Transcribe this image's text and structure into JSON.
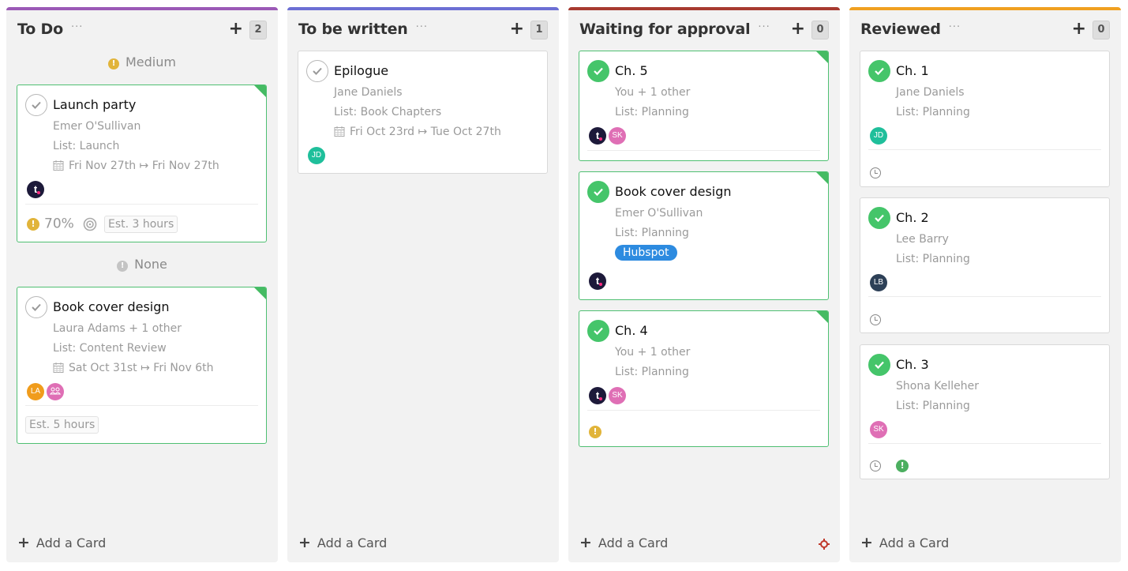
{
  "colors": {
    "todo": "#9b59b6",
    "to_be_written": "#6c6fd4",
    "waiting": "#a73a30",
    "reviewed": "#f0a020",
    "medium_priority": "#e1b43a",
    "none_priority": "#c4c4c4",
    "done_green": "#45c56a",
    "tag_blue": "#2d8be0",
    "high_priority_green": "#4caf60"
  },
  "columns": [
    {
      "title": "To Do",
      "more": "···",
      "count": "2",
      "add_label": "Add a Card",
      "groups": [
        {
          "label": "Medium",
          "cards": [
            {
              "title": "Launch party",
              "assignee": "Emer O'Sullivan",
              "list": "List: Launch",
              "dates": "Fri Nov 27th ↦ Fri Nov 27th",
              "avatars": [
                "t"
              ],
              "progress": "70%",
              "estimate": "Est. 3 hours"
            }
          ]
        },
        {
          "label": "None",
          "cards": [
            {
              "title": "Book cover design",
              "assignee": "Laura Adams + 1 other",
              "list": "List: Content Review",
              "dates": "Sat Oct 31st ↦ Fri Nov 6th",
              "avatars": [
                "LA",
                "group"
              ],
              "estimate": "Est. 5 hours"
            }
          ]
        }
      ]
    },
    {
      "title": "To be written",
      "more": "···",
      "count": "1",
      "add_label": "Add a Card",
      "cards": [
        {
          "title": "Epilogue",
          "assignee": "Jane Daniels",
          "list": "List: Book Chapters",
          "dates": "Fri Oct 23rd ↦ Tue Oct 27th",
          "avatars": [
            "JD"
          ]
        }
      ]
    },
    {
      "title": "Waiting for approval",
      "more": "···",
      "count": "0",
      "add_label": "Add a Card",
      "cards": [
        {
          "title": "Ch. 5",
          "assignee": "You + 1 other",
          "list": "List: Planning",
          "avatars": [
            "t",
            "SK"
          ]
        },
        {
          "title": "Book cover design",
          "assignee": "Emer O'Sullivan",
          "list": "List: Planning",
          "tag": "Hubspot",
          "avatars": [
            "t"
          ]
        },
        {
          "title": "Ch. 4",
          "assignee": "You + 1 other",
          "list": "List: Planning",
          "avatars": [
            "t",
            "SK"
          ]
        }
      ]
    },
    {
      "title": "Reviewed",
      "more": "···",
      "count": "0",
      "add_label": "Add a Card",
      "cards": [
        {
          "title": "Ch. 1",
          "assignee": "Jane Daniels",
          "list": "List: Planning",
          "avatars": [
            "JD"
          ]
        },
        {
          "title": "Ch. 2",
          "assignee": "Lee Barry",
          "list": "List: Planning",
          "avatars": [
            "LB"
          ]
        },
        {
          "title": "Ch. 3",
          "assignee": "Shona Kelleher",
          "list": "List: Planning",
          "avatars": [
            "SK"
          ]
        }
      ]
    }
  ]
}
